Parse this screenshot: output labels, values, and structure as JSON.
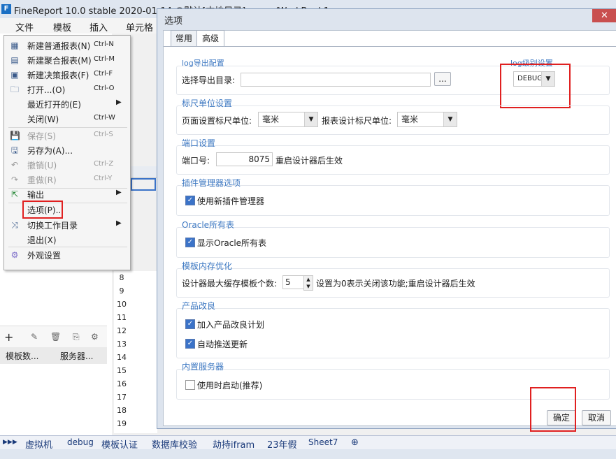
{
  "app": {
    "title": "FineReport 10.0 stable 2020-01-14 @默认[本地目录]   mem:/WorkBook1",
    "menu": [
      "文件",
      "模板",
      "插入",
      "单元格"
    ]
  },
  "file_menu": {
    "items": [
      {
        "label": "新建普通报表(N)",
        "shortcut": "Ctrl-N",
        "icon": "new-report-icon",
        "enabled": true
      },
      {
        "label": "新建聚合报表(M)",
        "shortcut": "Ctrl-M",
        "icon": "new-aggregate-icon",
        "enabled": true
      },
      {
        "label": "新建决策报表(F)",
        "shortcut": "Ctrl-F",
        "icon": "new-decision-icon",
        "enabled": true
      },
      {
        "label": "打开...(O)",
        "shortcut": "Ctrl-O",
        "icon": "folder-icon",
        "enabled": true
      },
      {
        "label": "最近打开的(E)",
        "shortcut": "",
        "icon": "",
        "enabled": true,
        "submenu": true
      },
      {
        "label": "关闭(W)",
        "shortcut": "Ctrl-W",
        "icon": "",
        "enabled": true
      },
      {
        "label": "保存(S)",
        "shortcut": "Ctrl-S",
        "icon": "save-icon",
        "enabled": false
      },
      {
        "label": "另存为(A)...",
        "shortcut": "",
        "icon": "save-as-icon",
        "enabled": true
      },
      {
        "label": "撤销(U)",
        "shortcut": "Ctrl-Z",
        "icon": "undo-icon",
        "enabled": false
      },
      {
        "label": "重做(R)",
        "shortcut": "Ctrl-Y",
        "icon": "redo-icon",
        "enabled": false
      },
      {
        "label": "输出",
        "shortcut": "",
        "icon": "export-icon",
        "enabled": true,
        "submenu": true
      },
      {
        "label": "选项(P)...",
        "shortcut": "",
        "icon": "",
        "enabled": true
      },
      {
        "label": "切换工作目录",
        "shortcut": "",
        "icon": "switch-icon",
        "enabled": true,
        "submenu": true
      },
      {
        "label": "退出(X)",
        "shortcut": "",
        "icon": "",
        "enabled": true
      },
      {
        "label": "外观设置",
        "shortcut": "",
        "icon": "appearance-icon",
        "enabled": true
      }
    ]
  },
  "left_tabs": [
    "模板数...",
    "服务器..."
  ],
  "row_numbers": [
    "8",
    "9",
    "10",
    "11",
    "12",
    "13",
    "14",
    "15",
    "16",
    "17",
    "18",
    "19"
  ],
  "sheet_tabs": [
    "虚拟机",
    "debug",
    "模板认证",
    "数据库校验",
    "劫持ifram",
    "23年假",
    "Sheet7"
  ],
  "dialog": {
    "title": "选项",
    "close": "✕",
    "tabs": [
      "常用",
      "高级"
    ],
    "log_export": {
      "title": "log导出配置",
      "label": "选择导出目录:",
      "value": "",
      "browse": "..."
    },
    "log_level": {
      "title": "log级别设置",
      "value": "DEBUG"
    },
    "ruler": {
      "title": "标尺单位设置",
      "page_label": "页面设置标尺单位:",
      "page_value": "毫米",
      "design_label": "报表设计标尺单位:",
      "design_value": "毫米"
    },
    "port": {
      "title": "端口设置",
      "label": "端口号:",
      "value": "8075",
      "note": "重启设计器后生效"
    },
    "plugin": {
      "title": "插件管理器选项",
      "checkbox": "使用新插件管理器",
      "checked": true
    },
    "oracle": {
      "title": "Oracle所有表",
      "checkbox": "显示Oracle所有表",
      "checked": true
    },
    "memory": {
      "title": "模板内存优化",
      "label": "设计器最大缓存模板个数:",
      "value": "5",
      "note": "设置为0表示关闭该功能;重启设计器后生效"
    },
    "improve": {
      "title": "产品改良",
      "checkbox1": "加入产品改良计划",
      "checked1": true,
      "checkbox2": "自动推送更新",
      "checked2": true
    },
    "server": {
      "title": "内置服务器",
      "checkbox": "使用时启动(推荐)",
      "checked": false
    },
    "ok": "确定",
    "cancel": "取消"
  },
  "colors": {
    "highlight": "#e02020",
    "group_title": "#3d78c2",
    "checkbox": "#3b73c8"
  }
}
